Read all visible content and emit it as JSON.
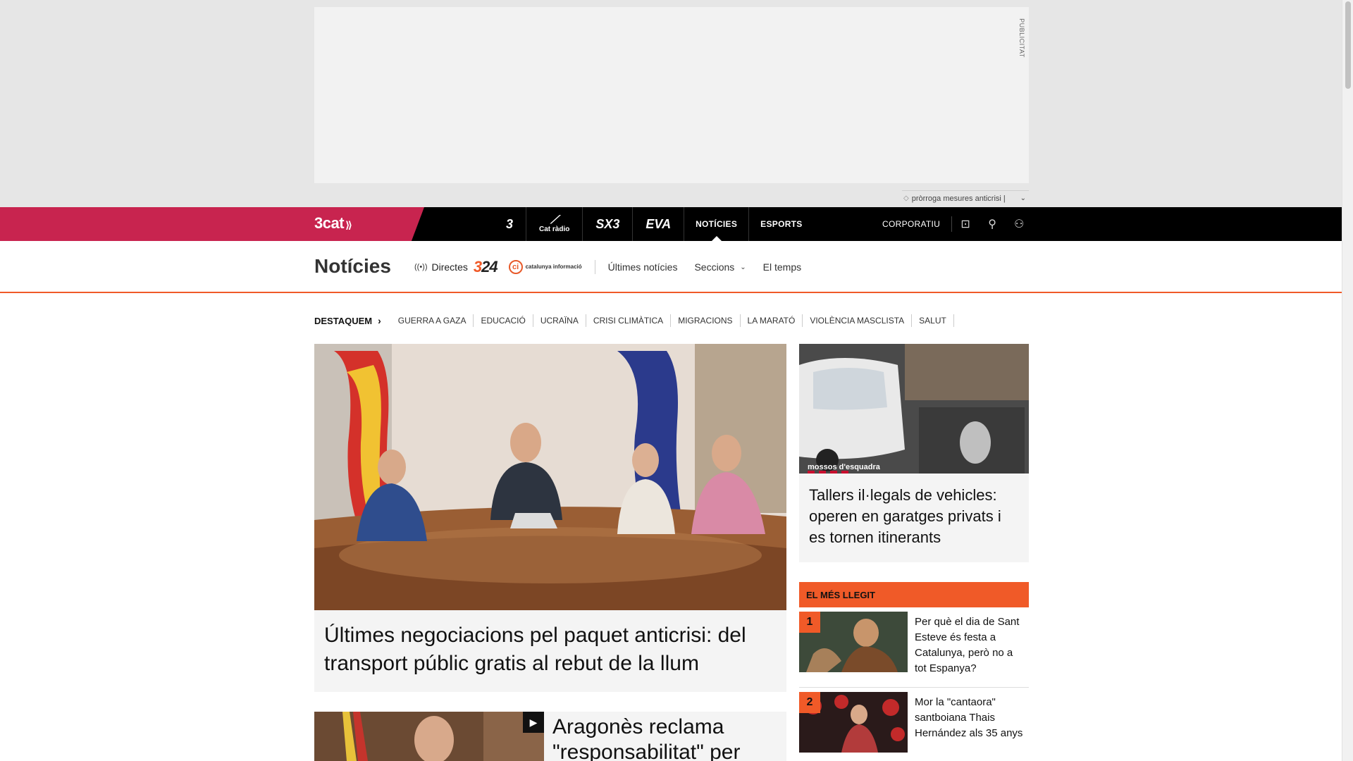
{
  "ad": {
    "label": "PUBLICITAT"
  },
  "ticker": {
    "text": "pròrroga mesures anticrisi |"
  },
  "topnav": {
    "brand": "3cat",
    "channels": [
      {
        "name": "3-logo",
        "label": "3"
      },
      {
        "name": "catradio-logo",
        "label": "Cat ràdio"
      },
      {
        "name": "sx3-logo",
        "label": "SX3"
      },
      {
        "name": "eva-logo",
        "label": "EVA"
      }
    ],
    "noticies": "NOTÍCIES",
    "esports": "ESPORTS",
    "corporatiu": "CORPORATIU"
  },
  "secnav": {
    "title": "Notícies",
    "directes": "Directes",
    "logo324": "324",
    "logo_ci": "catalunya informació",
    "ultimes": "Últimes notícies",
    "seccions": "Seccions",
    "temps": "El temps"
  },
  "destaquem": {
    "title": "DESTAQUEM",
    "tags": [
      "GUERRA A GAZA",
      "EDUCACIÓ",
      "UCRAÏNA",
      "CRISI CLIMÀTICA",
      "MIGRACIONS",
      "LA MARATÓ",
      "VIOLÈNCIA MASCLISTA",
      "SALUT"
    ]
  },
  "main_story": {
    "headline": "Últimes negociacions pel paquet anticrisi: del transport públic gratis al rebut de la llum"
  },
  "second_story": {
    "headline": "Aragonès reclama \"responsabilitat\" per"
  },
  "right_story": {
    "watermark": "mossos d'esquadra",
    "headline": "Tallers il·legals de vehicles: operen en garatges privats i es tornen itinerants"
  },
  "most_read": {
    "title": "EL MÉS LLEGIT",
    "items": [
      {
        "num": "1",
        "text": "Per què el dia de Sant Esteve és festa a Catalunya, però no a tot Espanya?"
      },
      {
        "num": "2",
        "text": "Mor la \"cantaora\" santboiana Thais Hernández als 35 anys"
      }
    ]
  },
  "colors": {
    "brand": "#c8244f",
    "accent": "#f05a28",
    "nav_bg": "#000000"
  }
}
